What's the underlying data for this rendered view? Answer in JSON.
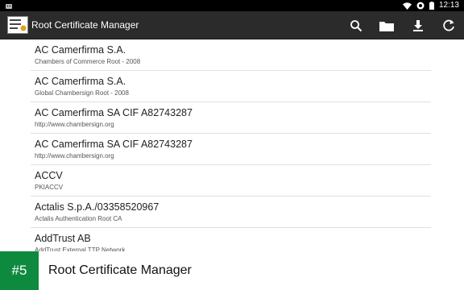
{
  "status_bar": {
    "time": "12:13",
    "icons": [
      "android-icon",
      "wifi-icon",
      "sync-icon",
      "battery-icon"
    ]
  },
  "action_bar": {
    "title": "Root Certificate Manager",
    "actions": [
      "search-icon",
      "folder-icon",
      "download-icon",
      "refresh-icon"
    ]
  },
  "certificates": [
    {
      "name": "AC Camerfirma S.A.",
      "detail": "Chambers of Commerce Root - 2008"
    },
    {
      "name": "AC Camerfirma S.A.",
      "detail": "Global Chambersign Root - 2008"
    },
    {
      "name": "AC Camerfirma SA CIF A82743287",
      "detail": "http://www.chambersign.org"
    },
    {
      "name": "AC Camerfirma SA CIF A82743287",
      "detail": "http://www.chambersign.org"
    },
    {
      "name": "ACCV",
      "detail": "PKIACCV"
    },
    {
      "name": "Actalis S.p.A./03358520967",
      "detail": "Actalis Authentication Root CA"
    },
    {
      "name": "AddTrust AB",
      "detail": "AddTrust External TTP Network"
    }
  ],
  "banner": {
    "badge": "#5",
    "title": "Root Certificate Manager"
  },
  "colors": {
    "action_bar": "#2b2b2b",
    "status_bar": "#000000",
    "badge_green": "#0e8a3e"
  }
}
